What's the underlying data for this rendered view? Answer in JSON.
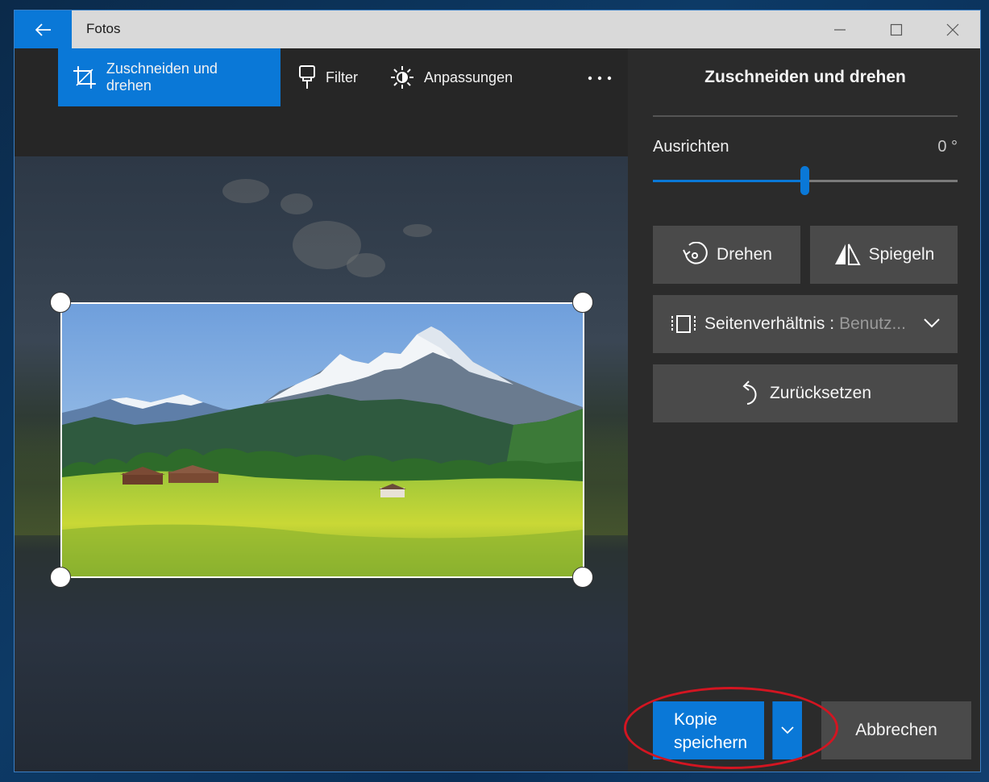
{
  "titlebar": {
    "title": "Fotos"
  },
  "toolbar": {
    "crop_rotate": "Zuschneiden und drehen",
    "filter": "Filter",
    "adjust": "Anpassungen",
    "more": "..."
  },
  "panel": {
    "title": "Zuschneiden und drehen",
    "straighten_label": "Ausrichten",
    "straighten_value": "0 °",
    "straighten_fraction": 0.5,
    "rotate_label": "Drehen",
    "flip_label": "Spiegeln",
    "aspect_label": "Seitenverhältnis :",
    "aspect_value": "Benutz...",
    "reset_label": "Zurücksetzen",
    "save_label": "Kopie speichern",
    "cancel_label": "Abbrechen"
  },
  "colors": {
    "accent": "#0a78d7",
    "annotation": "#d31521",
    "panel_bg": "#2b2b2b",
    "button_bg": "#4a4a4a"
  }
}
